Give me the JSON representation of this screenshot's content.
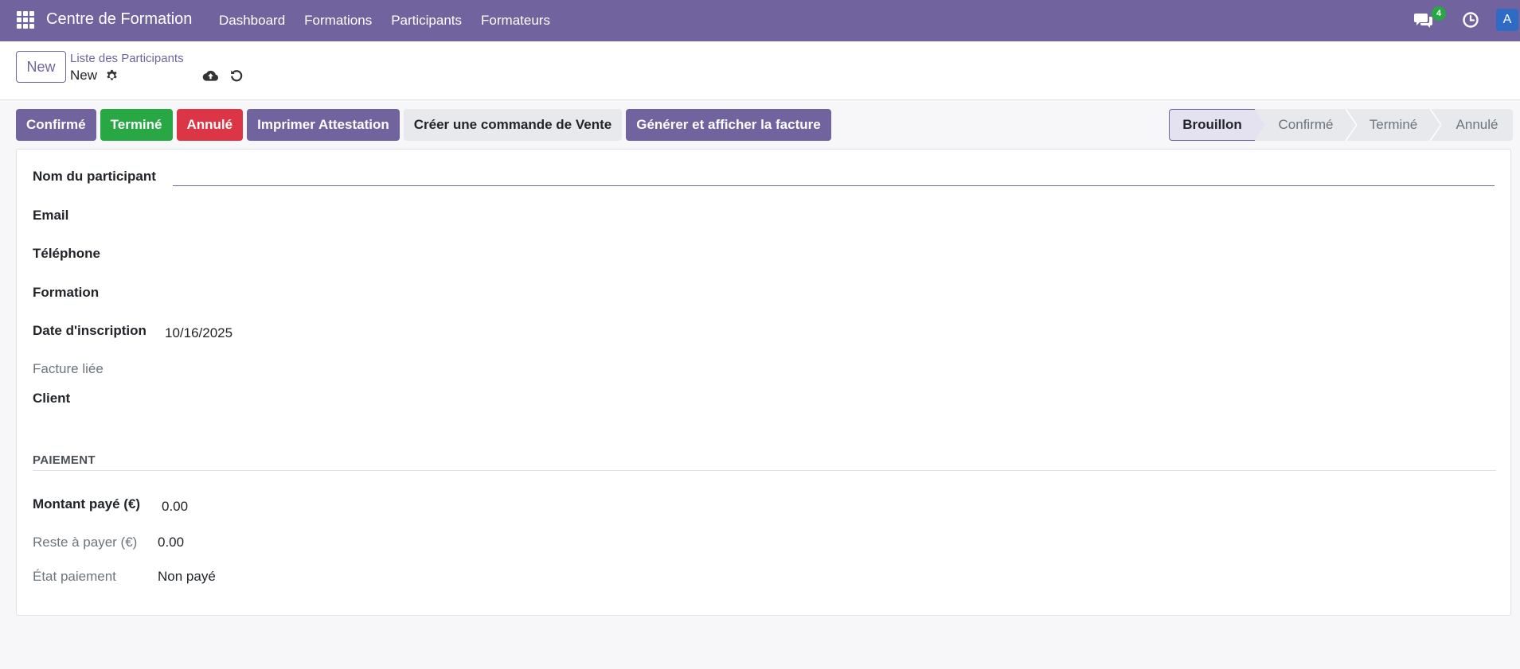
{
  "navbar": {
    "app_name": "Centre de Formation",
    "menu": [
      "Dashboard",
      "Formations",
      "Participants",
      "Formateurs"
    ],
    "chat_badge": "4",
    "avatar_letter": "A",
    "brand_color": "#71639e"
  },
  "control_panel": {
    "new_button": "New",
    "breadcrumb": "Liste des Participants",
    "record_name": "New"
  },
  "actions": {
    "confirm": "Confirmé",
    "done": "Terminé",
    "cancel": "Annulé",
    "print": "Imprimer Attestation",
    "sale_order": "Créer une commande de Vente",
    "invoice": "Générer et afficher la facture"
  },
  "statusbar": {
    "stages": [
      "Brouillon",
      "Confirmé",
      "Terminé",
      "Annulé"
    ],
    "active": "Brouillon"
  },
  "form": {
    "name_label": "Nom du participant",
    "name_value": "",
    "email_label": "Email",
    "phone_label": "Téléphone",
    "formation_label": "Formation",
    "date_label": "Date d'inscription",
    "date_value": "10/16/2025",
    "invoice_label": "Facture liée",
    "client_label": "Client",
    "payment_section": "PAIEMENT",
    "paid_label": "Montant payé (€)",
    "paid_value": "0.00",
    "remaining_label": "Reste à payer (€)",
    "remaining_value": "0.00",
    "status_label": "État paiement",
    "status_value": "Non payé"
  }
}
